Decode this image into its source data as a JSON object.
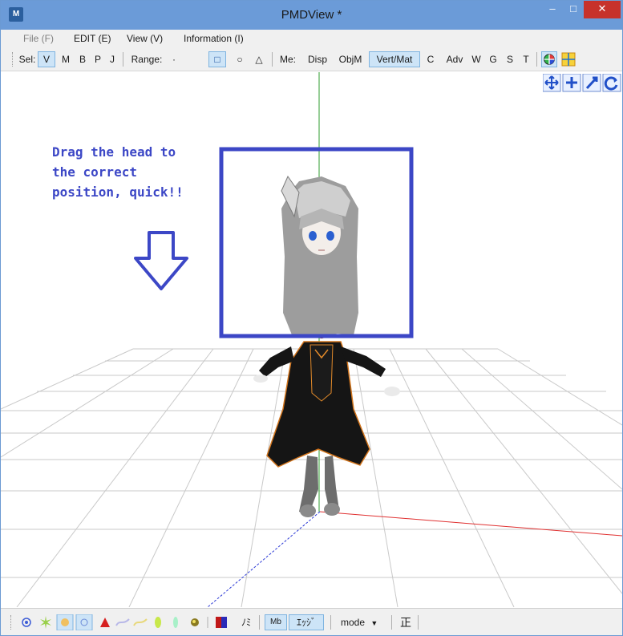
{
  "window": {
    "title": "PMDView *",
    "min_glyph": "–",
    "max_glyph": "□",
    "close_glyph": "✕"
  },
  "menu": {
    "items": [
      "File (F)",
      "EDIT (E)",
      "View (V)",
      "Information (I)"
    ]
  },
  "toolbar": {
    "sel_label": "Sel:",
    "sel_buttons": [
      "V",
      "M",
      "B",
      "P",
      "J"
    ],
    "range_label": "Range:",
    "range_buttons": [
      "·",
      "□",
      "○",
      "△"
    ],
    "me_label": "Me:",
    "me_buttons": [
      "Disp",
      "ObjM",
      "Vert/Mat",
      "C",
      "Adv",
      "W",
      "G",
      "S",
      "T"
    ]
  },
  "annotation": {
    "text": "Drag the head to\nthe correct\nposition, quick!!",
    "color": "#3c47c6"
  },
  "bottom_toolbar": {
    "mode_label": "mode",
    "ni_label": "ﾉﾐ",
    "mb_label": "Mb",
    "edge_label": "ｴｯｼﾞ",
    "sei_label": "正"
  },
  "colors": {
    "titlebar": "#6b9bd8",
    "active_toggle": "#cde4f7",
    "accent_blue": "#3c47c6",
    "axis_red": "#e03030",
    "axis_green": "#2f9e2f",
    "axis_blue": "#2c3ad6"
  }
}
